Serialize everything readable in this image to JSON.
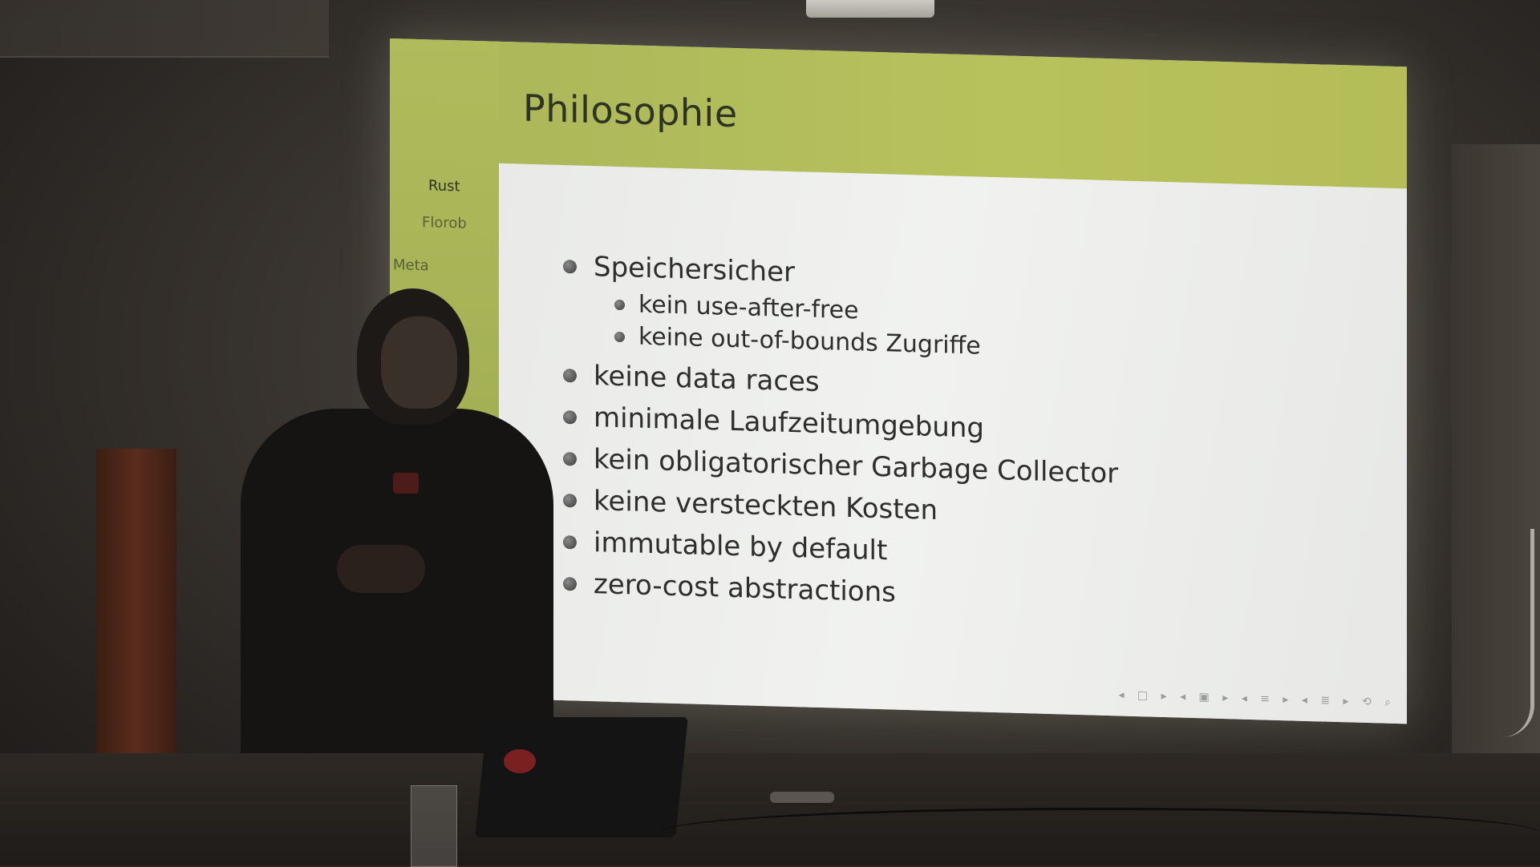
{
  "slide": {
    "title": "Philosophie",
    "sidebar_nav": [
      "Rust",
      "Florob",
      "Meta"
    ],
    "bullets": [
      {
        "text": "Speichersicher",
        "sub": [
          "kein use-after-free",
          "keine out-of-bounds Zugriffe"
        ]
      },
      {
        "text": "keine data races",
        "sub": []
      },
      {
        "text": "minimale Laufzeitumgebung",
        "sub": []
      },
      {
        "text": "kein obligatorischer Garbage Collector",
        "sub": []
      },
      {
        "text": "keine versteckten Kosten",
        "sub": []
      },
      {
        "text": "immutable by default",
        "sub": []
      },
      {
        "text": "zero-cost abstractions",
        "sub": []
      }
    ],
    "colors": {
      "header": "#b4bd57",
      "content_bg": "#eeefec",
      "text": "#2e2e2e"
    }
  }
}
